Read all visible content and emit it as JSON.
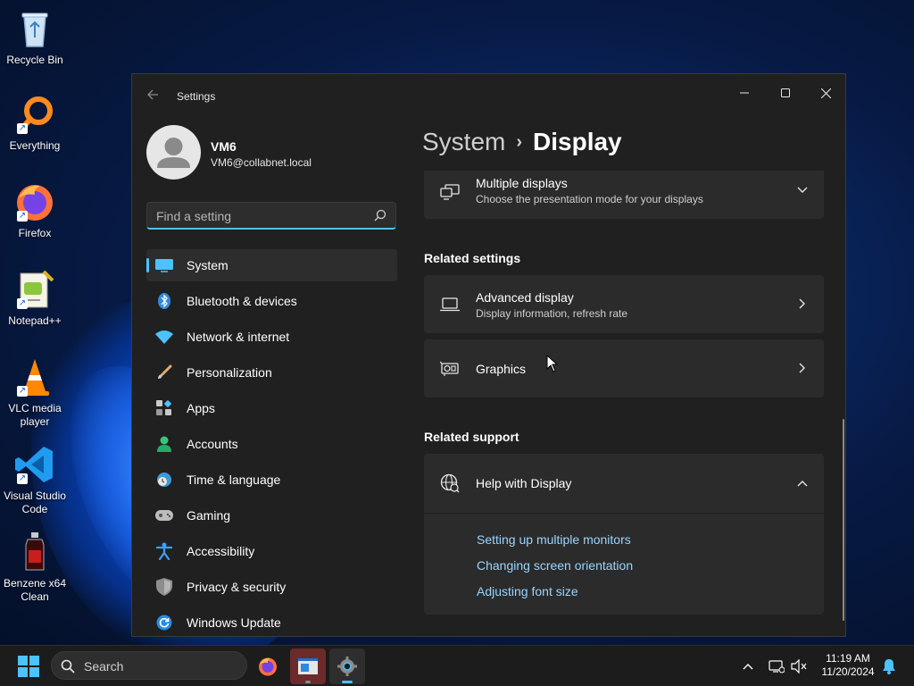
{
  "desktop": {
    "icons": [
      {
        "label": "Recycle Bin",
        "icon": "recycle-bin-icon"
      },
      {
        "label": "Everything",
        "icon": "everything-search-icon"
      },
      {
        "label": "Firefox",
        "icon": "firefox-icon"
      },
      {
        "label": "Notepad++",
        "icon": "notepad-plus-plus-icon"
      },
      {
        "label": "VLC media player",
        "icon": "vlc-cone-icon"
      },
      {
        "label": "Visual Studio Code",
        "icon": "vscode-icon"
      },
      {
        "label": "Benzene x64 Clean",
        "icon": "benzene-bottle-icon"
      }
    ]
  },
  "window": {
    "app_title": "Settings",
    "controls": [
      "minimize",
      "maximize",
      "close"
    ]
  },
  "profile": {
    "name": "VM6",
    "email": "VM6@collabnet.local"
  },
  "search": {
    "placeholder": "Find a setting"
  },
  "nav": {
    "items": [
      {
        "label": "System",
        "icon": "system-monitor-icon",
        "active": true
      },
      {
        "label": "Bluetooth & devices",
        "icon": "bluetooth-icon"
      },
      {
        "label": "Network & internet",
        "icon": "wifi-icon"
      },
      {
        "label": "Personalization",
        "icon": "brush-icon"
      },
      {
        "label": "Apps",
        "icon": "apps-grid-icon"
      },
      {
        "label": "Accounts",
        "icon": "person-icon"
      },
      {
        "label": "Time & language",
        "icon": "globe-clock-icon"
      },
      {
        "label": "Gaming",
        "icon": "gamepad-icon"
      },
      {
        "label": "Accessibility",
        "icon": "accessibility-icon"
      },
      {
        "label": "Privacy & security",
        "icon": "shield-icon"
      },
      {
        "label": "Windows Update",
        "icon": "update-icon"
      }
    ]
  },
  "content": {
    "breadcrumb_parent": "System",
    "breadcrumb_current": "Display",
    "multiple_displays": {
      "title": "Multiple displays",
      "subtitle": "Choose the presentation mode for your displays"
    },
    "related_settings_heading": "Related settings",
    "advanced_display": {
      "title": "Advanced display",
      "subtitle": "Display information, refresh rate"
    },
    "graphics": {
      "title": "Graphics"
    },
    "related_support_heading": "Related support",
    "help": {
      "title": "Help with Display",
      "links": [
        "Setting up multiple monitors",
        "Changing screen orientation",
        "Adjusting font size"
      ]
    }
  },
  "taskbar": {
    "search_label": "Search",
    "time": "11:19 AM",
    "date": "11/20/2024"
  },
  "colors": {
    "accent": "#4cc2ff",
    "link": "#99d5ff",
    "window_bg": "#202020",
    "card_bg": "#2b2b2b"
  }
}
